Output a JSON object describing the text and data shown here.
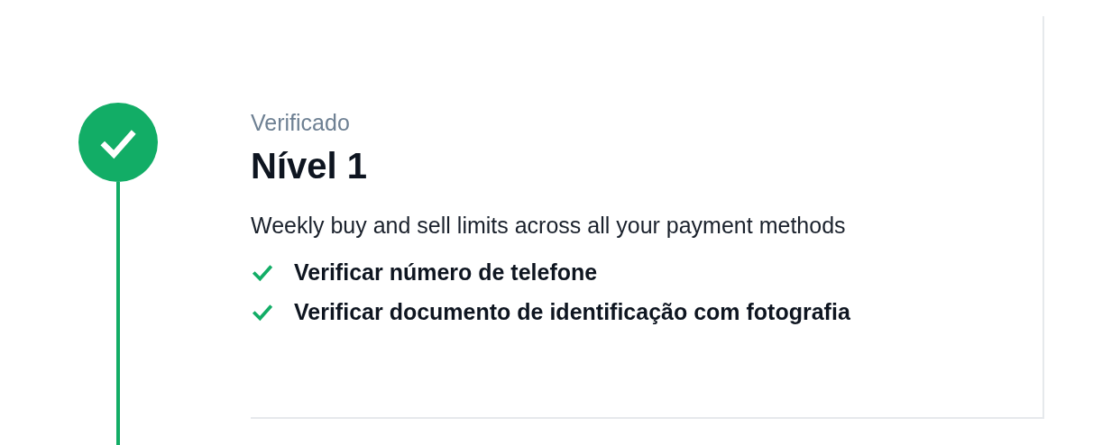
{
  "level": {
    "status": "Verificado",
    "title": "Nível 1",
    "verified": true,
    "description": "Weekly buy and sell limits across all your payment methods",
    "requirements": [
      {
        "label": "Verificar número de telefone",
        "done": true
      },
      {
        "label": "Verificar documento de identificação com fotografia",
        "done": true
      }
    ]
  }
}
